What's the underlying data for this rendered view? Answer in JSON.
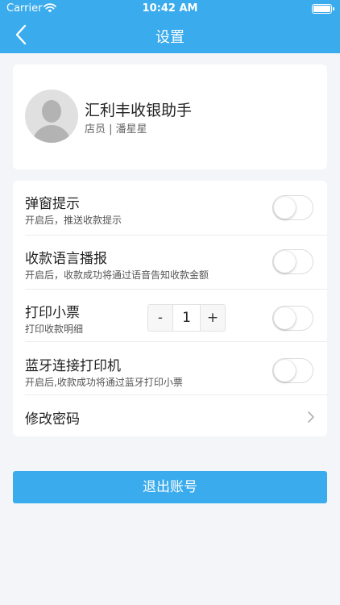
{
  "status_bar": {
    "carrier": "Carrier",
    "time": "10:42 AM"
  },
  "navbar": {
    "title": "设置",
    "back_icon": "chevron-left-icon"
  },
  "profile": {
    "name": "汇利丰收银助手",
    "role_line": "店员 | 潘星星"
  },
  "settings": [
    {
      "title": "弹窗提示",
      "subtitle": "开启后，推送收款提示",
      "enabled": false
    },
    {
      "title": "收款语言播报",
      "subtitle": "开启后，收款成功将通过语音告知收款金额",
      "enabled": false
    },
    {
      "title": "打印小票",
      "subtitle": "打印收款明细",
      "enabled": false
    },
    {
      "title": "蓝牙连接打印机",
      "subtitle": "开启后,收款成功将通过蓝牙打印小票",
      "enabled": false
    },
    {
      "title": "修改密码"
    }
  ],
  "print_stepper": {
    "minus_label": "-",
    "quantity": "1",
    "plus_label": "+"
  },
  "logout_label": "退出账号",
  "colors": {
    "brand": "#3aabec",
    "background": "#f3f5f8"
  }
}
